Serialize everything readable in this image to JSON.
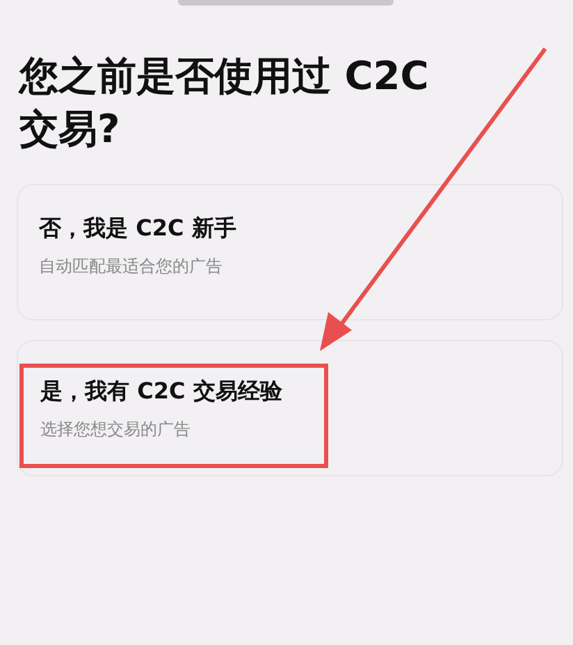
{
  "title": "您之前是否使用过 C2C 交易?",
  "options": [
    {
      "title": "否，我是 C2C 新手",
      "subtitle": "自动匹配最适合您的广告",
      "highlighted": false
    },
    {
      "title": "是，我有 C2C 交易经验",
      "subtitle": "选择您想交易的广告",
      "highlighted": true
    }
  ]
}
